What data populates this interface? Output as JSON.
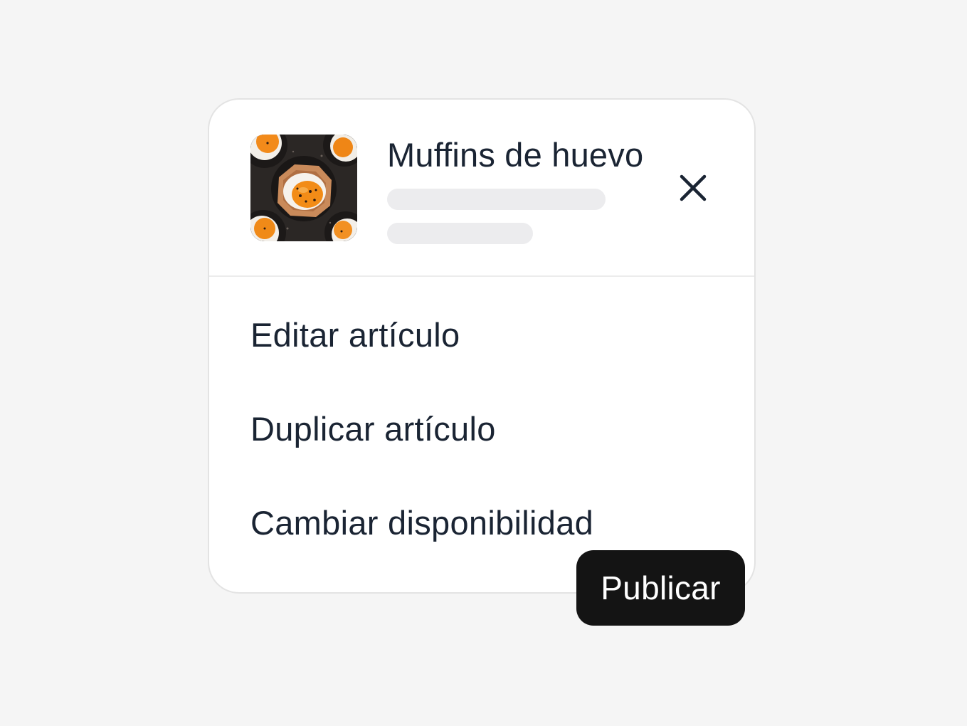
{
  "item": {
    "title": "Muffins de huevo",
    "thumbnail_icon": "egg-muffin-photo"
  },
  "header": {
    "close_icon": "close-icon"
  },
  "menu": {
    "items": [
      {
        "label": "Editar artículo"
      },
      {
        "label": "Duplicar artículo"
      },
      {
        "label": "Cambiar disponibilidad"
      }
    ]
  },
  "tooltip": {
    "label": "Publicar"
  },
  "colors": {
    "background": "#f5f5f5",
    "card": "#ffffff",
    "text": "#1a2433",
    "skeleton": "#ececee",
    "tooltip_bg": "#141414",
    "tooltip_text": "#ffffff"
  }
}
